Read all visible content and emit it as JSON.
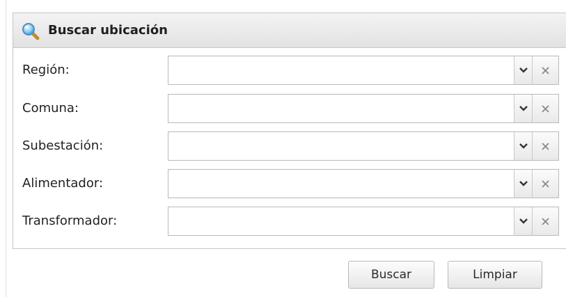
{
  "panel": {
    "title": "Buscar ubicación",
    "icon": "search-icon"
  },
  "fields": [
    {
      "label": "Región:",
      "value": ""
    },
    {
      "label": "Comuna:",
      "value": ""
    },
    {
      "label": "Subestación:",
      "value": ""
    },
    {
      "label": "Alimentador:",
      "value": ""
    },
    {
      "label": "Transformador:",
      "value": ""
    }
  ],
  "buttons": {
    "search_label": "Buscar",
    "clear_label": "Limpiar"
  }
}
